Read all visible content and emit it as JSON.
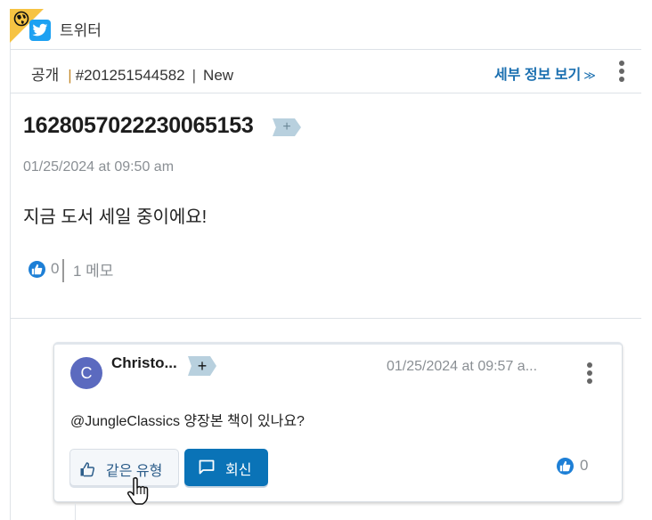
{
  "header": {
    "channel_name": "트위터",
    "icons": {
      "badge": "globe-icon",
      "channel": "twitter-icon"
    }
  },
  "meta": {
    "visibility": "공개",
    "ticket_id": "#201251544582",
    "status": "New",
    "details_link": "세부 정보 보기",
    "details_icon": "chevrons-down-icon",
    "more_icon": "kebab-menu-icon"
  },
  "post": {
    "title": "1628057022230065153",
    "tag_add": "+",
    "date": "01/25/2024 at 09:50 am",
    "body": "지금 도서 세일 중이에요!",
    "likes": "0",
    "memo": "1 메모"
  },
  "comment": {
    "avatar_initial": "C",
    "author": "Christo...",
    "tag_add": "+",
    "date": "01/25/2024 at 09:57 a...",
    "body": "@JungleClassics 양장본 책이 있나요?",
    "like_button": "같은 유형",
    "reply_button": "회신",
    "likes": "0"
  },
  "colors": {
    "accent": "#1a6fb0",
    "reply_button": "#0a73b7",
    "avatar": "#5b6abf",
    "badge": "#f6c343",
    "tag": "#b8d0de",
    "twitter": "#1da1f2"
  }
}
